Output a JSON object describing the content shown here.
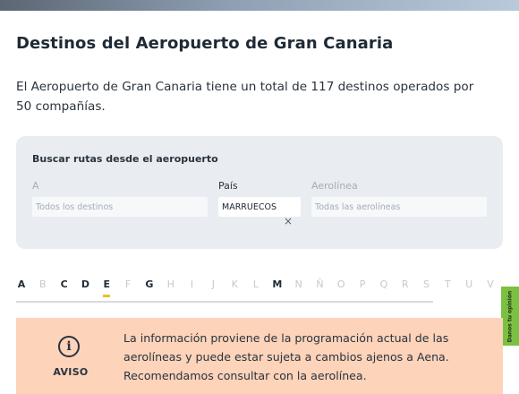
{
  "page": {
    "title": "Destinos del Aeropuerto de Gran Canaria",
    "intro": "El Aeropuerto de Gran Canaria tiene un total de 117 destinos operados por 50 compañías."
  },
  "search": {
    "title": "Buscar rutas desde el aeropuerto",
    "to_label": "A",
    "to_placeholder": "Todos los destinos",
    "country_label": "País",
    "country_value": "MARRUECOS",
    "clear_symbol": "×",
    "airline_label": "Aerolínea",
    "airline_placeholder": "Todas las aerolíneas"
  },
  "alphabet": [
    {
      "letter": "A",
      "enabled": true,
      "selected": false
    },
    {
      "letter": "B",
      "enabled": false,
      "selected": false
    },
    {
      "letter": "C",
      "enabled": true,
      "selected": false
    },
    {
      "letter": "D",
      "enabled": true,
      "selected": false
    },
    {
      "letter": "E",
      "enabled": true,
      "selected": true
    },
    {
      "letter": "F",
      "enabled": false,
      "selected": false
    },
    {
      "letter": "G",
      "enabled": true,
      "selected": false
    },
    {
      "letter": "H",
      "enabled": false,
      "selected": false
    },
    {
      "letter": "I",
      "enabled": false,
      "selected": false
    },
    {
      "letter": "J",
      "enabled": false,
      "selected": false
    },
    {
      "letter": "K",
      "enabled": false,
      "selected": false
    },
    {
      "letter": "L",
      "enabled": false,
      "selected": false
    },
    {
      "letter": "M",
      "enabled": true,
      "selected": false
    },
    {
      "letter": "N",
      "enabled": false,
      "selected": false
    },
    {
      "letter": "Ñ",
      "enabled": false,
      "selected": false
    },
    {
      "letter": "O",
      "enabled": false,
      "selected": false
    },
    {
      "letter": "P",
      "enabled": false,
      "selected": false
    },
    {
      "letter": "Q",
      "enabled": false,
      "selected": false
    },
    {
      "letter": "R",
      "enabled": false,
      "selected": false
    },
    {
      "letter": "S",
      "enabled": false,
      "selected": false
    },
    {
      "letter": "T",
      "enabled": false,
      "selected": false
    },
    {
      "letter": "U",
      "enabled": false,
      "selected": false
    },
    {
      "letter": "V",
      "enabled": false,
      "selected": false
    }
  ],
  "notice": {
    "label": "AVISO",
    "icon": "info-icon",
    "text": "La información proviene de la programación actual de las aerolíneas y puede estar sujeta a cambios ajenos a Aena. Recomendamos consultar con la aerolínea."
  },
  "feedback_tab": {
    "label": "Danos tu opinión"
  },
  "colors": {
    "panel_bg": "#e9edf2",
    "notice_bg": "#fdd3ba",
    "selected_underline": "#e8c22a",
    "feedback_bg": "#7bc043"
  }
}
